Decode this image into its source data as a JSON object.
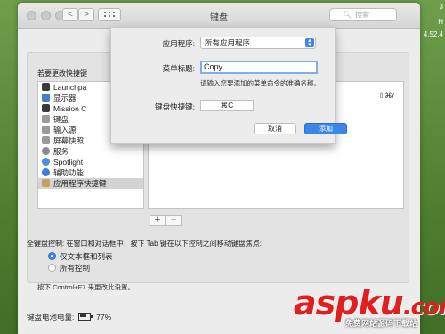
{
  "desktop": {
    "side_text_1": "3",
    "side_text_2": "H",
    "side_text_3": "4.52.4"
  },
  "window": {
    "title": "键盘",
    "search_placeholder": "搜索",
    "nav_back": "<",
    "nav_forward": ">"
  },
  "shortcuts": {
    "hint": "若要更改快捷键",
    "items": [
      {
        "label": "Launchpa",
        "icon": "launchpad-icon",
        "color": "#3a3a3a"
      },
      {
        "label": "显示器",
        "icon": "display-icon",
        "color": "#4a7fc8"
      },
      {
        "label": "Mission C",
        "icon": "mission-control-icon",
        "color": "#3a3a3a"
      },
      {
        "label": "键盘",
        "icon": "keyboard-icon",
        "color": "#9a9a9a"
      },
      {
        "label": "输入源",
        "icon": "input-source-icon",
        "color": "#9a9a9a"
      },
      {
        "label": "屏幕快照",
        "icon": "screenshot-icon",
        "color": "#9a9a9a"
      },
      {
        "label": "服务",
        "icon": "services-gear-icon",
        "color": "#8a8a8a"
      },
      {
        "label": "Spotlight",
        "icon": "spotlight-icon",
        "color": "#4a90e2"
      },
      {
        "label": "辅助功能",
        "icon": "accessibility-icon",
        "color": "#3b7de0"
      },
      {
        "label": "应用程序快捷键",
        "icon": "app-shortcuts-icon",
        "color": "#c8a060"
      }
    ],
    "selected_index": 9,
    "detail_shortcut": "⇧⌘/",
    "add_label": "+",
    "remove_label": "−"
  },
  "full_keyboard": {
    "label": "全键盘控制:  在窗口和对话框中，按下 Tab 键在以下控制之间移动键盘焦点:",
    "option_1": "仅文本框和列表",
    "option_2": "所有控制",
    "selected": 1,
    "note": "按下 Control+F7 来更改此设置。"
  },
  "battery": {
    "label": "键盘电池电量:",
    "value": "77%"
  },
  "sheet": {
    "app_label": "应用程序:",
    "app_value": "所有应用程序",
    "menu_title_label": "菜单标题:",
    "menu_title_value": "Copy",
    "help_text": "请输入您要添加的菜单命令的准确名称。",
    "shortcut_label": "键盘快捷键:",
    "shortcut_value": "⌘C",
    "cancel": "取消",
    "add": "添加"
  },
  "watermark": {
    "brand_a": "asp",
    "brand_b": "ku",
    "tld": ".com",
    "sub": "免费网站源码下载站"
  }
}
